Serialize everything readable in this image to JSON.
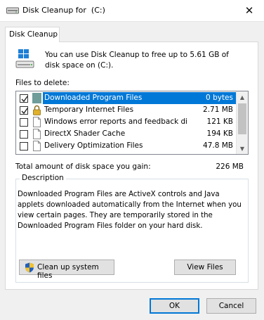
{
  "window": {
    "title": "Disk Cleanup for  (C:)",
    "close_symbol": "✕"
  },
  "tab": {
    "label": "Disk Cleanup"
  },
  "intro": {
    "text": "You can use Disk Cleanup to free up to 5.61 GB of disk space on  (C:)."
  },
  "files_label": "Files to delete:",
  "files": [
    {
      "name": "Downloaded Program Files",
      "size": "0 bytes",
      "checked": true,
      "selected": true,
      "icon": "folder-icon"
    },
    {
      "name": "Temporary Internet Files",
      "size": "2.71 MB",
      "checked": true,
      "selected": false,
      "icon": "lock-icon"
    },
    {
      "name": "Windows error reports and feedback di...",
      "size": "121 KB",
      "checked": false,
      "selected": false,
      "icon": "document-icon"
    },
    {
      "name": "DirectX Shader Cache",
      "size": "194 KB",
      "checked": false,
      "selected": false,
      "icon": "document-icon"
    },
    {
      "name": "Delivery Optimization Files",
      "size": "47.8 MB",
      "checked": false,
      "selected": false,
      "icon": "document-icon"
    }
  ],
  "total": {
    "label": "Total amount of disk space you gain:",
    "value": "226 MB"
  },
  "description": {
    "legend": "Description",
    "text": "Downloaded Program Files are ActiveX controls and Java applets downloaded automatically from the Internet when you view certain pages. They are temporarily stored in the Downloaded Program Files folder on your hard disk."
  },
  "buttons": {
    "cleanup_system": "Clean up system files",
    "view_files": "View Files",
    "ok": "OK",
    "cancel": "Cancel"
  },
  "colors": {
    "selection": "#0078d7",
    "dialog_bg": "#f0f0f0"
  }
}
